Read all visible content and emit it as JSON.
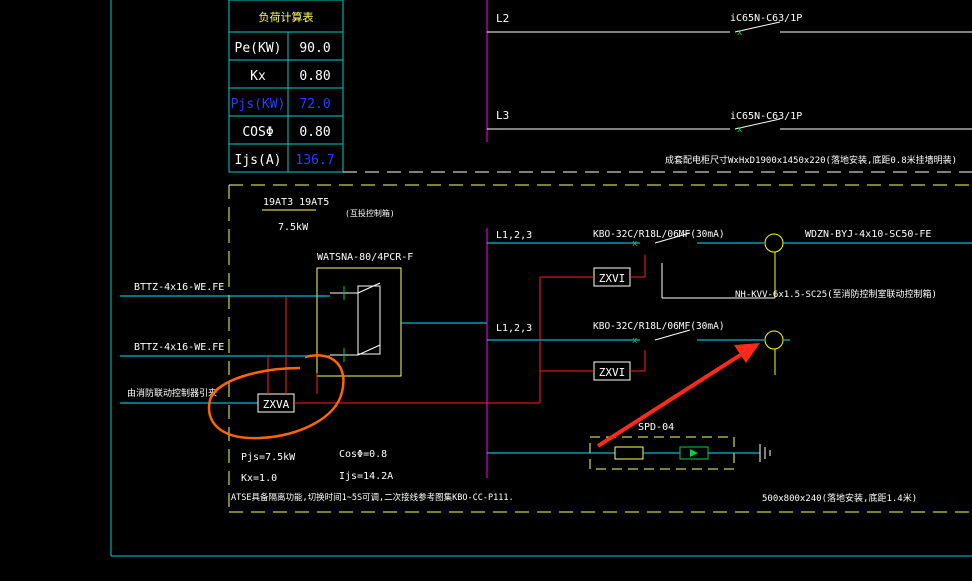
{
  "colors": {
    "background": "#000000",
    "frame": "#00cccc",
    "busbar": "#ff00ff",
    "wire": "#ffffff",
    "wire_red": "#ff2020",
    "wire_cyan": "#00e5ff",
    "dash_border": "#ffff66",
    "text_white": "#ffffff",
    "text_yellow": "#ffff66",
    "text_blue": "#2040ff",
    "breaker_green": "#00cc44",
    "lamp_yellow": "#ffff00",
    "annotation_orange": "#ff6600",
    "annotation_arrow": "#ff2a1a"
  },
  "load_table": {
    "title": "负荷计算表",
    "rows": [
      {
        "label": "Pe(KW)",
        "value": "90.0"
      },
      {
        "label": "Kx",
        "value": "0.80"
      },
      {
        "label": "Pjs(KW)",
        "value": "72.0"
      },
      {
        "label": "COSΦ",
        "value": "0.80"
      },
      {
        "label": "Ijs(A)",
        "value": "136.7"
      }
    ]
  },
  "upper_circuits": [
    {
      "phase": "L2",
      "breaker": "iC65N-C63/1P"
    },
    {
      "phase": "L3",
      "breaker": "iC65N-C63/1P"
    }
  ],
  "upper_note": "成套配电柜尺寸WxHxD1900x1450x220(落地安装,底距0.8米挂墙明装)",
  "panel": {
    "ats_ratings": "19AT3 19AT5",
    "ats_power": "7.5kW",
    "ats_note": "(互投控制箱)",
    "ats_model": "WATSNA-80/4PCR-F",
    "incoming_1": "BTTZ-4x16-WE.FE",
    "incoming_2": "BTTZ-4x16-WE.FE",
    "fire_signal": "由消防联动控制器引来",
    "zxva_label": "ZXVA",
    "pjs": "Pjs=7.5kW",
    "cos": "CosΦ=0.8",
    "kx": "Kx=1.0",
    "ijs": "Ijs=14.2A",
    "bottom_note": "ATSE具备隔离功能,切换时间1~5S可调,二次接线参考图集KBO-CC-P111.",
    "box_size": "500x800x240(落地安装,底距1.4米)"
  },
  "branches": [
    {
      "phase": "L1,2,3",
      "breaker": "KBO-32C/R18L/06MF(30mA)",
      "relay": "ZXVI",
      "cable": "WDZN-BYJ-4x10-SC50-FE"
    },
    {
      "phase": "L1,2,3",
      "breaker": "KBO-32C/R18L/06MF(30mA)",
      "relay": "ZXVI",
      "cable": ""
    }
  ],
  "control_cable": "NH-KVV-6x1.5-SC25(至消防控制室联动控制箱)",
  "spd": {
    "label": "SPD-04"
  }
}
